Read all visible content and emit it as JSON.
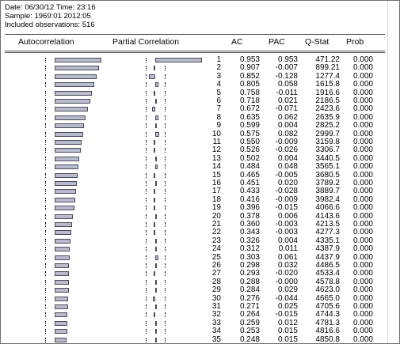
{
  "meta": {
    "date_line": "Date: 06/30/12   Time: 23:16",
    "sample_line": "Sample: 1969:01 2012:05",
    "obs_line": "Included observations: 516"
  },
  "headers": {
    "autocorrelation": "Autocorrelation",
    "partial_correlation": "Partial Correlation",
    "ac": "AC",
    "pac": "PAC",
    "qstat": "Q-Stat",
    "prob": "Prob"
  },
  "rows": [
    {
      "lag": "1",
      "ac": "0.953",
      "pac": "0.953",
      "q": "471.22",
      "prob": "0.000"
    },
    {
      "lag": "2",
      "ac": "0.907",
      "pac": "-0.007",
      "q": "899.21",
      "prob": "0.000"
    },
    {
      "lag": "3",
      "ac": "0.852",
      "pac": "-0.128",
      "q": "1277.4",
      "prob": "0.000"
    },
    {
      "lag": "4",
      "ac": "0.805",
      "pac": "0.058",
      "q": "1615.8",
      "prob": "0.000"
    },
    {
      "lag": "5",
      "ac": "0.758",
      "pac": "-0.011",
      "q": "1916.6",
      "prob": "0.000"
    },
    {
      "lag": "6",
      "ac": "0.718",
      "pac": "0.021",
      "q": "2186.5",
      "prob": "0.000"
    },
    {
      "lag": "7",
      "ac": "0.672",
      "pac": "-0.071",
      "q": "2423.6",
      "prob": "0.000"
    },
    {
      "lag": "8",
      "ac": "0.635",
      "pac": "0.062",
      "q": "2635.9",
      "prob": "0.000"
    },
    {
      "lag": "9",
      "ac": "0.599",
      "pac": "0.004",
      "q": "2825.2",
      "prob": "0.000"
    },
    {
      "lag": "10",
      "ac": "0.575",
      "pac": "0.082",
      "q": "2999.7",
      "prob": "0.000"
    },
    {
      "lag": "11",
      "ac": "0.550",
      "pac": "-0.009",
      "q": "3159.8",
      "prob": "0.000"
    },
    {
      "lag": "12",
      "ac": "0.526",
      "pac": "-0.026",
      "q": "3306.7",
      "prob": "0.000"
    },
    {
      "lag": "13",
      "ac": "0.502",
      "pac": "0.004",
      "q": "3440.5",
      "prob": "0.000"
    },
    {
      "lag": "14",
      "ac": "0.484",
      "pac": "0.048",
      "q": "3565.1",
      "prob": "0.000"
    },
    {
      "lag": "15",
      "ac": "0.465",
      "pac": "-0.005",
      "q": "3680.5",
      "prob": "0.000"
    },
    {
      "lag": "16",
      "ac": "0.451",
      "pac": "0.020",
      "q": "3789.2",
      "prob": "0.000"
    },
    {
      "lag": "17",
      "ac": "0.433",
      "pac": "-0.028",
      "q": "3889.7",
      "prob": "0.000"
    },
    {
      "lag": "18",
      "ac": "0.416",
      "pac": "-0.009",
      "q": "3982.4",
      "prob": "0.000"
    },
    {
      "lag": "19",
      "ac": "0.396",
      "pac": "-0.015",
      "q": "4066.6",
      "prob": "0.000"
    },
    {
      "lag": "20",
      "ac": "0.378",
      "pac": "0.006",
      "q": "4143.6",
      "prob": "0.000"
    },
    {
      "lag": "21",
      "ac": "0.360",
      "pac": "-0.003",
      "q": "4213.5",
      "prob": "0.000"
    },
    {
      "lag": "22",
      "ac": "0.343",
      "pac": "-0.003",
      "q": "4277.3",
      "prob": "0.000"
    },
    {
      "lag": "23",
      "ac": "0.326",
      "pac": "0.004",
      "q": "4335.1",
      "prob": "0.000"
    },
    {
      "lag": "24",
      "ac": "0.312",
      "pac": "0.011",
      "q": "4387.9",
      "prob": "0.000"
    },
    {
      "lag": "25",
      "ac": "0.303",
      "pac": "0.061",
      "q": "4437.9",
      "prob": "0.000"
    },
    {
      "lag": "26",
      "ac": "0.298",
      "pac": "0.032",
      "q": "4486.5",
      "prob": "0.000"
    },
    {
      "lag": "27",
      "ac": "0.293",
      "pac": "-0.020",
      "q": "4533.4",
      "prob": "0.000"
    },
    {
      "lag": "28",
      "ac": "0.288",
      "pac": "-0.000",
      "q": "4578.8",
      "prob": "0.000"
    },
    {
      "lag": "29",
      "ac": "0.284",
      "pac": "0.029",
      "q": "4623.0",
      "prob": "0.000"
    },
    {
      "lag": "30",
      "ac": "0.276",
      "pac": "-0.044",
      "q": "4665.0",
      "prob": "0.000"
    },
    {
      "lag": "31",
      "ac": "0.271",
      "pac": "0.025",
      "q": "4705.6",
      "prob": "0.000"
    },
    {
      "lag": "32",
      "ac": "0.264",
      "pac": "-0.015",
      "q": "4744.3",
      "prob": "0.000"
    },
    {
      "lag": "33",
      "ac": "0.259",
      "pac": "0.012",
      "q": "4781.3",
      "prob": "0.000"
    },
    {
      "lag": "34",
      "ac": "0.253",
      "pac": "0.015",
      "q": "4816.6",
      "prob": "0.000"
    },
    {
      "lag": "35",
      "ac": "0.248",
      "pac": "0.015",
      "q": "4850.8",
      "prob": "0.000"
    }
  ],
  "colors": {
    "bar_fill": "#b8bbd0",
    "bar_border": "#4a4a5a"
  }
}
